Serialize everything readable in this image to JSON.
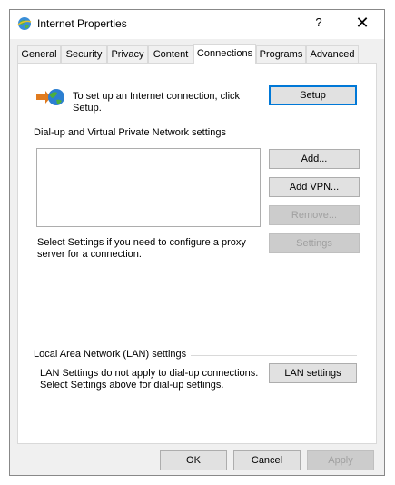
{
  "window": {
    "title": "Internet Properties",
    "help_label": "?",
    "close_label": "✕"
  },
  "tabs": [
    {
      "label": "General"
    },
    {
      "label": "Security"
    },
    {
      "label": "Privacy"
    },
    {
      "label": "Content"
    },
    {
      "label": "Connections",
      "active": true
    },
    {
      "label": "Programs"
    },
    {
      "label": "Advanced"
    }
  ],
  "connections": {
    "setup_text": "To set up an Internet connection, click Setup.",
    "setup_button": "Setup",
    "dialup_group_label": "Dial-up and Virtual Private Network settings",
    "add_button": "Add...",
    "add_vpn_button": "Add VPN...",
    "remove_button": "Remove...",
    "proxy_text": "Select Settings if you need to configure a proxy server for a connection.",
    "settings_button": "Settings",
    "lan_group_label": "Local Area Network (LAN) settings",
    "lan_text": "LAN Settings do not apply to dial-up connections. Select Settings above for dial-up settings.",
    "lan_settings_button": "LAN settings"
  },
  "footer": {
    "ok": "OK",
    "cancel": "Cancel",
    "apply": "Apply"
  },
  "icons": {
    "title_icon": "internet-globe-icon",
    "connection_icon": "internet-connection-wizard-icon"
  },
  "colors": {
    "accent": "#0078d7",
    "panel_bg": "#ffffff",
    "window_bg": "#f0f0f0",
    "button_bg": "#e1e1e1",
    "disabled_text": "#a0a0a0"
  }
}
